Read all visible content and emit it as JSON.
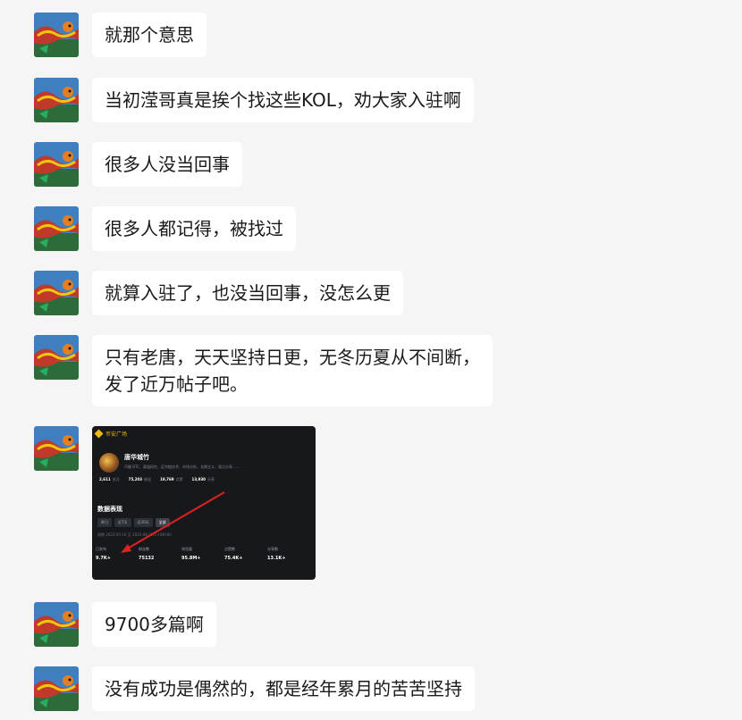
{
  "messages": [
    {
      "type": "text",
      "lines": [
        "就那个意思"
      ]
    },
    {
      "type": "text",
      "lines": [
        "当初滢哥真是挨个找这些KOL，劝大家入驻啊"
      ]
    },
    {
      "type": "text",
      "lines": [
        "很多人没当回事"
      ]
    },
    {
      "type": "text",
      "lines": [
        "很多人都记得，被找过"
      ]
    },
    {
      "type": "text",
      "lines": [
        "就算入驻了，也没当回事，没怎么更"
      ]
    },
    {
      "type": "text",
      "lines": [
        "只有老唐，天天坚持日更，无冬历夏从不间断，",
        "发了近万帖子吧。"
      ]
    },
    {
      "type": "image"
    },
    {
      "type": "text",
      "lines": [
        "9700多篇啊"
      ]
    },
    {
      "type": "text",
      "lines": [
        "没有成功是偶然的，都是经年累月的苦苦坚持"
      ]
    }
  ],
  "screenshot": {
    "app_name": "币安广场",
    "profile_name": "唐华城竹",
    "profile_desc": "币圈 BTC、赛道研究、区块链技术、市场分析、长期主义、观点分享……",
    "stats": [
      {
        "value": "2,611",
        "label": "关注"
      },
      {
        "value": "75,203",
        "label": "粉丝"
      },
      {
        "value": "19,769",
        "label": "点赞"
      },
      {
        "value": "13,930",
        "label": "分享"
      }
    ],
    "section_title": "数据表现",
    "tabs": [
      "昨日",
      "近7天",
      "近30天",
      "全部"
    ],
    "date_range": "周期 2023-05-16 至 2025-08 (UTC+08:00)",
    "metrics": [
      {
        "label": "已发布",
        "value": "9.7K+"
      },
      {
        "label": "粉丝数",
        "value": "75132"
      },
      {
        "label": "浏览量",
        "value": "95.8M+"
      },
      {
        "label": "点赞数",
        "value": "75.4K+"
      },
      {
        "label": "分享数",
        "value": "13.1K+"
      }
    ],
    "accent_color": "#f0b90b",
    "arrow_color": "#e02020"
  }
}
